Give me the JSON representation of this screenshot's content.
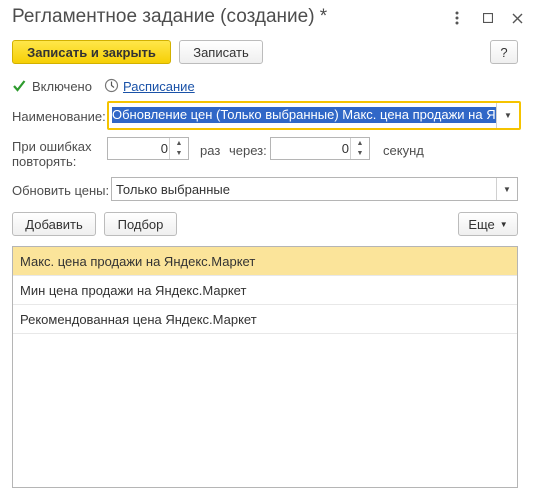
{
  "window": {
    "title": "Регламентное задание (создание) *",
    "menu_icon": "more-vertical-icon",
    "maximize_icon": "maximize-icon",
    "close_icon": "close-icon"
  },
  "toolbar": {
    "save_close_label": "Записать и закрыть",
    "save_label": "Записать",
    "help_label": "?"
  },
  "enabled": {
    "label": "Включено",
    "checked": true
  },
  "schedule": {
    "label": "Расписание",
    "icon": "clock-icon"
  },
  "name_field": {
    "label": "Наименование:",
    "value": "Обновление цен (Только выбранные) Макс. цена продажи на Яндекс.Маркет"
  },
  "retry": {
    "label_line1": "При ошибках",
    "label_line2": "повторять:",
    "times_value": "0",
    "times_unit": "раз",
    "interval_label": "через:",
    "interval_value": "0",
    "interval_unit": "секунд"
  },
  "update_prices": {
    "label": "Обновить цены:",
    "value": "Только выбранные"
  },
  "list_toolbar": {
    "add_label": "Добавить",
    "pick_label": "Подбор",
    "more_label": "Еще"
  },
  "items": [
    {
      "label": "Макс. цена продажи на Яндекс.Маркет",
      "selected": true
    },
    {
      "label": "Мин цена продажи на Яндекс.Маркет",
      "selected": false
    },
    {
      "label": "Рекомендованная цена Яндекс.Маркет",
      "selected": false
    }
  ],
  "colors": {
    "accent": "#f6cf05",
    "selection": "#fbe49a",
    "link": "#1a52a8",
    "check": "#2e9b2e"
  }
}
